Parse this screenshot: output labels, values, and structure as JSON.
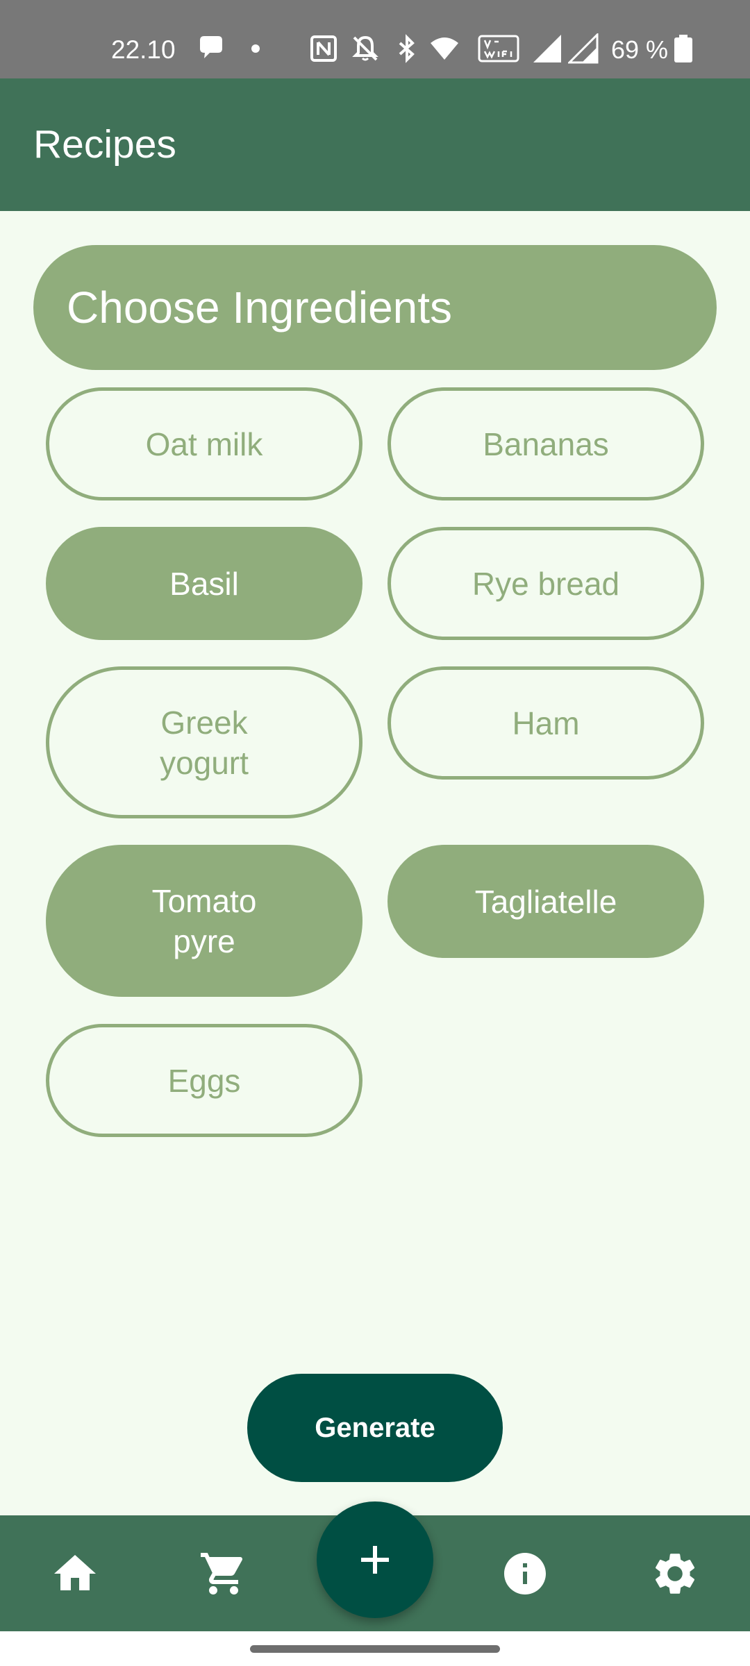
{
  "status_bar": {
    "time": "22.10",
    "battery": "69 %",
    "icons": [
      "chat-bubble-icon",
      "dot-icon",
      "nfc-icon",
      "bell-off-icon",
      "bluetooth-icon",
      "wifi-icon",
      "vowifi-icon",
      "signal-icon",
      "signal-icon",
      "battery-icon"
    ]
  },
  "app_bar": {
    "title": "Recipes"
  },
  "section": {
    "title": "Choose Ingredients"
  },
  "ingredients": [
    {
      "lines": [
        "Oat milk"
      ],
      "selected": false
    },
    {
      "lines": [
        "Bananas"
      ],
      "selected": false
    },
    {
      "lines": [
        "Basil"
      ],
      "selected": true
    },
    {
      "lines": [
        "Rye bread"
      ],
      "selected": false
    },
    {
      "lines": [
        "Greek",
        "yogurt"
      ],
      "selected": false
    },
    {
      "lines": [
        "Ham"
      ],
      "selected": false
    },
    {
      "lines": [
        "Tomato",
        "pyre"
      ],
      "selected": true
    },
    {
      "lines": [
        "Tagliatelle"
      ],
      "selected": true
    },
    {
      "lines": [
        "Eggs"
      ],
      "selected": false
    }
  ],
  "generate_button": {
    "label": "Generate"
  },
  "bottom_nav": {
    "items": [
      "home-icon",
      "cart-icon",
      "add-icon",
      "info-icon",
      "settings-icon"
    ]
  },
  "colors": {
    "app_bar": "#407258",
    "chip_accent": "#90ad7c",
    "button": "#004f43",
    "background": "#f3fbf0",
    "status_bar": "#787878"
  }
}
